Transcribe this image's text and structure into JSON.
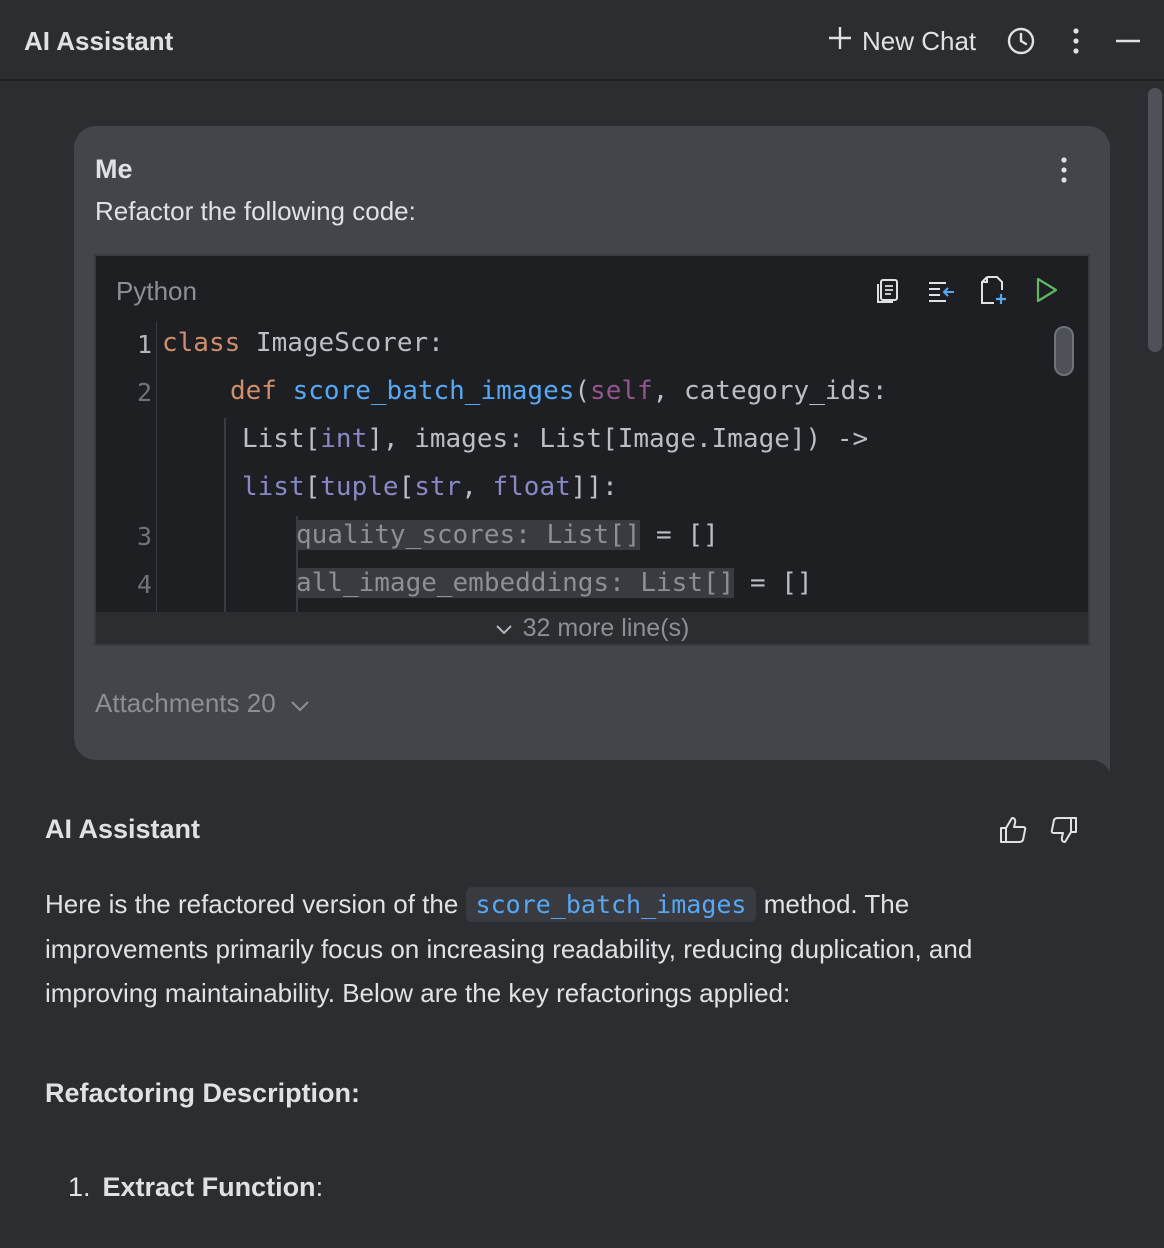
{
  "header": {
    "title": "AI Assistant",
    "new_chat_label": "New Chat",
    "icons": [
      "plus-icon",
      "history-icon",
      "more-vertical-icon",
      "minimize-icon"
    ]
  },
  "user_message": {
    "author": "Me",
    "text": "Refactor the following code:",
    "code_block": {
      "language": "Python",
      "toolbar_icons": [
        "copy-icon",
        "insert-at-caret-icon",
        "new-file-icon",
        "run-icon"
      ],
      "lines": [
        {
          "num": "1",
          "text": "class ImageScorer:"
        },
        {
          "num": "2",
          "text": "def score_batch_images(self, category_ids: List[int], images: List[Image.Image]) -> list[tuple[str, float]]:"
        },
        {
          "num": "3",
          "text": "quality_scores: List[] = []"
        },
        {
          "num": "4",
          "text": "all_image_embeddings: List[] = []"
        }
      ],
      "more_lines_label": "32 more line(s)"
    },
    "attachments_label": "Attachments 20"
  },
  "assistant_message": {
    "author": "AI Assistant",
    "intro_before": "Here is the refactored version of the ",
    "inline_code": "score_batch_images",
    "intro_after": " method. The improvements primarily focus on increasing readability, reducing duplication, and improving maintainability. Below are the key refactorings applied:",
    "section_title": "Refactoring Description:",
    "list": [
      {
        "num": "1.",
        "title": "Extract Function",
        "suffix": ":"
      }
    ]
  },
  "colors": {
    "background": "#2b2d30",
    "bubble": "#43454a",
    "code_bg": "#1e1f22",
    "keyword": "#cf8e6d",
    "function": "#56a8f5",
    "self": "#94558d",
    "builtin": "#8888c6",
    "run_green": "#5fb865"
  }
}
